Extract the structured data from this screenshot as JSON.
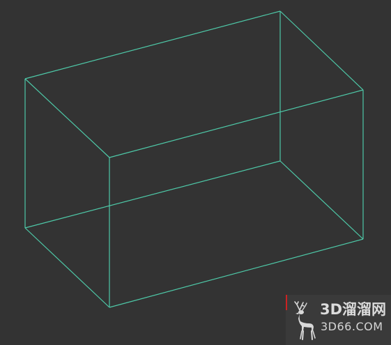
{
  "viewport": {
    "background": "#333333",
    "wire_color": "#4ec9a8",
    "object": "box-wireframe"
  },
  "watermark": {
    "title": "3D溜溜网",
    "subtitle": "3D66.COM",
    "logo_icon": "deer-icon",
    "text_color": "#dcdcdc"
  }
}
